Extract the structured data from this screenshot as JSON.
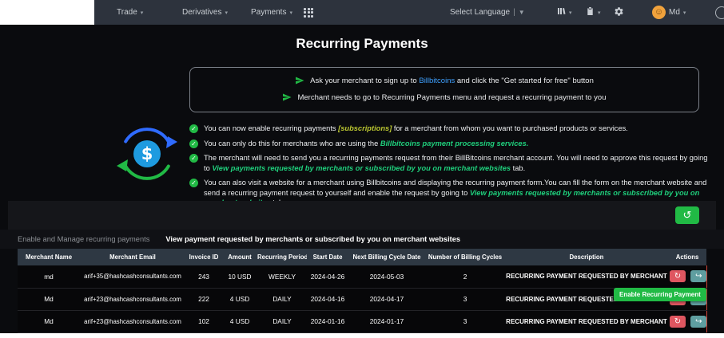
{
  "nav": {
    "menus": [
      {
        "label": "Trade"
      },
      {
        "label": "Derivatives"
      },
      {
        "label": "Payments"
      }
    ],
    "language_label": "Select Language",
    "user_label": "Md"
  },
  "page": {
    "title": "Recurring Payments",
    "info_lines": [
      {
        "segments": [
          {
            "text": "Ask your merchant to sign up to "
          },
          {
            "text": "Billbitcoins"
          },
          {
            "text": " and click the \"Get started for free\" button"
          }
        ]
      },
      {
        "segments": [
          {
            "text": "Merchant needs to go to Recurring Payments menu and request a recurring payment to you"
          }
        ]
      }
    ],
    "bullets": [
      {
        "segments": [
          {
            "text": "You can now enable recurring payments "
          },
          {
            "text": "[subscriptions]"
          },
          {
            "text": " for a merchant from whom you want to purchased products or services."
          }
        ]
      },
      {
        "segments": [
          {
            "text": "You can only do this for merchants who are using the "
          },
          {
            "text": "Billbitcoins payment processing services."
          }
        ]
      },
      {
        "segments": [
          {
            "text": "The merchant will need to send you a recurring payments request from their BillBitcoins merchant account. You will need to approve this request by going to "
          },
          {
            "text": "View payments requested by merchants or subscribed by you on merchant websites"
          },
          {
            "text": " tab."
          }
        ]
      },
      {
        "segments": [
          {
            "text": "You can also visit a website for a merchant using Billbitcoins and displaying the recurring payment form.You can fill the form on the merchant website and send a recurring payment request to yourself and enable the request by going to "
          },
          {
            "text": "View payments requested by merchants or subscribed by you on merchant websites"
          },
          {
            "text": " tab."
          }
        ]
      }
    ]
  },
  "tabs": [
    {
      "label": "Enable and Manage recurring payments",
      "active": false
    },
    {
      "label": "View payment requested by merchants or subscribed by you on merchant websites",
      "active": true
    }
  ],
  "table": {
    "headers": [
      "Merchant Name",
      "Merchant Email",
      "Invoice ID",
      "Amount",
      "Recurring Period",
      "Start Date",
      "Next Billing Cycle Date",
      "Number of Billing Cycles",
      "Description",
      "Actions"
    ],
    "rows": [
      {
        "cells": [
          "md",
          "arif+35@hashcashconsultants.com",
          "243",
          "10 USD",
          "WEEKLY",
          "2024-04-26",
          "2024-05-03",
          "2",
          "RECURRING PAYMENT REQUESTED BY MERCHANT"
        ]
      },
      {
        "cells": [
          "Md",
          "arif+23@hashcashconsultants.com",
          "222",
          "4 USD",
          "DAILY",
          "2024-04-16",
          "2024-04-17",
          "3",
          "RECURRING PAYMENT REQUESTED BY MERCHANT"
        ]
      },
      {
        "cells": [
          "Md",
          "arif+23@hashcashconsultants.com",
          "102",
          "4 USD",
          "DAILY",
          "2024-01-16",
          "2024-01-17",
          "3",
          "RECURRING PAYMENT REQUESTED BY MERCHANT"
        ]
      }
    ]
  },
  "tooltip": {
    "label": "Enable Recurring Payment"
  },
  "colors": {
    "navbar_bg": "#2d333d",
    "content_bg": "#0a0b0e",
    "accent_green": "#21ba45",
    "link_blue": "#3fa1ff",
    "em_green": "#1fcf7c",
    "em_yellow": "#b9c531",
    "table_header_bg": "#2e3843",
    "action_red": "#df5660",
    "action_teal": "#5f9ea0"
  }
}
